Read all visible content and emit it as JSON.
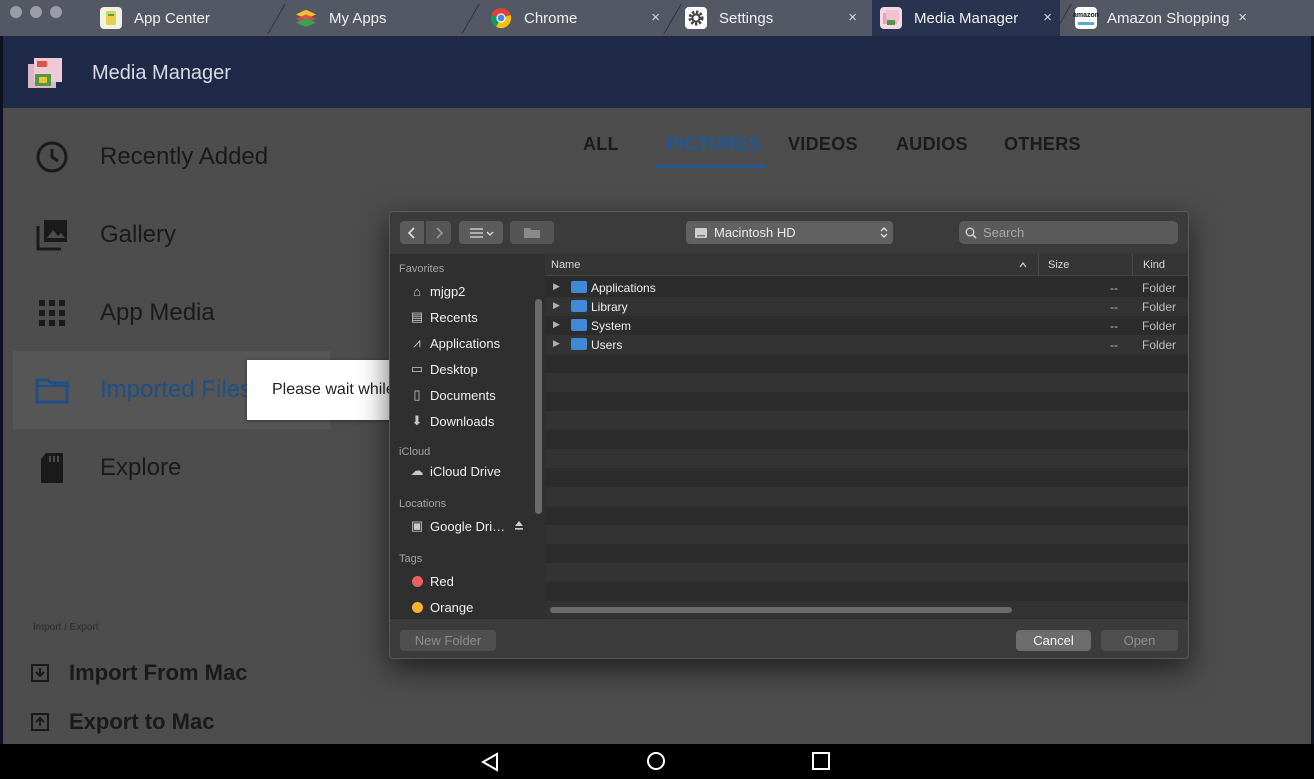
{
  "tabs": [
    {
      "label": "App Center",
      "closable": false,
      "icon": "app-center-icon"
    },
    {
      "label": "My Apps",
      "closable": false,
      "icon": "my-apps-icon"
    },
    {
      "label": "Chrome",
      "closable": true,
      "icon": "chrome-icon"
    },
    {
      "label": "Settings",
      "closable": true,
      "icon": "settings-gear-icon"
    },
    {
      "label": "Media Manager",
      "closable": true,
      "active": true,
      "icon": "media-manager-icon"
    },
    {
      "label": "Amazon Shopping",
      "closable": true,
      "icon": "amazon-icon"
    }
  ],
  "tab_close_glyph": "×",
  "app": {
    "title": "Media Manager"
  },
  "sidebar": {
    "items": [
      {
        "label": "Recently Added",
        "icon": "clock-icon"
      },
      {
        "label": "Gallery",
        "icon": "gallery-icon"
      },
      {
        "label": "App Media",
        "icon": "grid-icon"
      },
      {
        "label": "Imported Files",
        "icon": "folder-icon",
        "selected": true
      },
      {
        "label": "Explore",
        "icon": "sd-card-icon"
      }
    ],
    "section_label": "Import / Export",
    "actions": [
      {
        "label": "Import From Mac",
        "icon": "import-icon"
      },
      {
        "label": "Export to Mac",
        "icon": "export-icon"
      }
    ]
  },
  "content_tabs": [
    {
      "label": "ALL"
    },
    {
      "label": "PICTURES",
      "selected": true
    },
    {
      "label": "VIDEOS"
    },
    {
      "label": "AUDIOS"
    },
    {
      "label": "OTHERS"
    }
  ],
  "toast": {
    "text": "Please wait while"
  },
  "dialog": {
    "location": "Macintosh HD",
    "search_placeholder": "Search",
    "sidebar": {
      "favorites_header": "Favorites",
      "favorites": [
        {
          "label": "mjgp2",
          "icon": "home-icon"
        },
        {
          "label": "Recents",
          "icon": "recents-icon"
        },
        {
          "label": "Applications",
          "icon": "applications-icon"
        },
        {
          "label": "Desktop",
          "icon": "desktop-icon"
        },
        {
          "label": "Documents",
          "icon": "documents-icon"
        },
        {
          "label": "Downloads",
          "icon": "downloads-icon"
        }
      ],
      "icloud_header": "iCloud",
      "icloud": [
        {
          "label": "iCloud Drive",
          "icon": "cloud-icon"
        }
      ],
      "locations_header": "Locations",
      "locations": [
        {
          "label": "Google Dri…",
          "icon": "drive-icon"
        }
      ],
      "tags_header": "Tags",
      "tags": [
        {
          "label": "Red",
          "color": "#ec5f5f"
        },
        {
          "label": "Orange",
          "color": "#f5b12f"
        }
      ]
    },
    "columns": {
      "name": "Name",
      "size": "Size",
      "kind": "Kind"
    },
    "rows": [
      {
        "name": "Applications",
        "size": "--",
        "kind": "Folder"
      },
      {
        "name": "Library",
        "size": "--",
        "kind": "Folder"
      },
      {
        "name": "System",
        "size": "--",
        "kind": "Folder"
      },
      {
        "name": "Users",
        "size": "--",
        "kind": "Folder"
      }
    ],
    "buttons": {
      "new_folder": "New Folder",
      "cancel": "Cancel",
      "open": "Open"
    }
  }
}
